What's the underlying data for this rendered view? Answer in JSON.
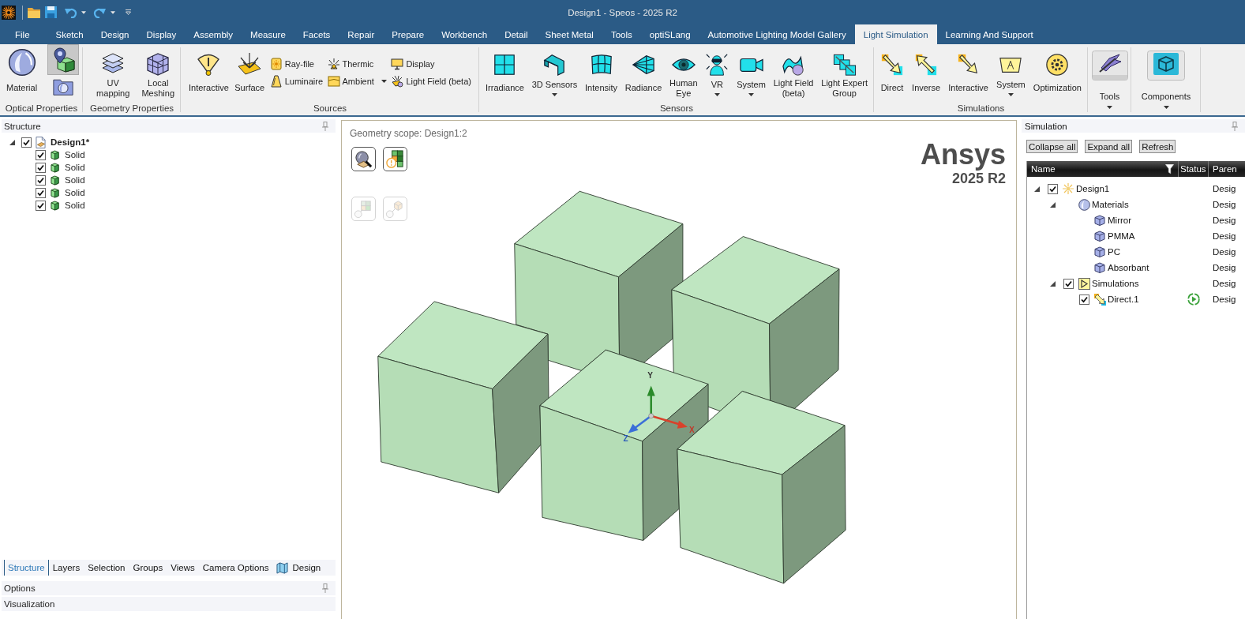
{
  "title_bar": {
    "title": "Design1 - Speos - 2025 R2"
  },
  "menu_tabs": [
    {
      "label": "File",
      "selected": false
    },
    {
      "label": "Sketch",
      "selected": false
    },
    {
      "label": "Design",
      "selected": false
    },
    {
      "label": "Display",
      "selected": false
    },
    {
      "label": "Assembly",
      "selected": false
    },
    {
      "label": "Measure",
      "selected": false
    },
    {
      "label": "Facets",
      "selected": false
    },
    {
      "label": "Repair",
      "selected": false
    },
    {
      "label": "Prepare",
      "selected": false
    },
    {
      "label": "Workbench",
      "selected": false
    },
    {
      "label": "Detail",
      "selected": false
    },
    {
      "label": "Sheet Metal",
      "selected": false
    },
    {
      "label": "Tools",
      "selected": false
    },
    {
      "label": "optiSLang",
      "selected": false
    },
    {
      "label": "Automotive Lighting Model Gallery",
      "selected": false
    },
    {
      "label": "Light Simulation",
      "selected": true
    },
    {
      "label": "Learning And Support",
      "selected": false
    }
  ],
  "ribbon": {
    "groups": [
      {
        "label": "Optical Properties",
        "items": [
          {
            "kind": "large",
            "label": "Material"
          },
          {
            "kind": "stack",
            "items": [
              {
                "kind": "icon",
                "pressed": true
              },
              {
                "kind": "icon",
                "pressed": false
              }
            ]
          }
        ]
      },
      {
        "label": "Geometry Properties",
        "items": [
          {
            "kind": "large",
            "label": "UV mapping"
          },
          {
            "kind": "large",
            "label": "Local\nMeshing"
          }
        ]
      },
      {
        "label": "Sources",
        "items": [
          {
            "kind": "large",
            "label": "Interactive"
          },
          {
            "kind": "large",
            "label": "Surface"
          },
          {
            "kind": "stack",
            "items": [
              {
                "kind": "small",
                "label": "Ray-file"
              },
              {
                "kind": "small",
                "label": "Luminaire"
              }
            ]
          },
          {
            "kind": "stack",
            "items": [
              {
                "kind": "small",
                "label": "Thermic"
              },
              {
                "kind": "small",
                "label": "Ambient",
                "dropdown": true
              }
            ]
          },
          {
            "kind": "stack",
            "items": [
              {
                "kind": "small",
                "label": "Display"
              },
              {
                "kind": "small",
                "label": "Light Field (beta)"
              }
            ]
          }
        ]
      },
      {
        "label": "Sensors",
        "items": [
          {
            "kind": "large",
            "label": "Irradiance"
          },
          {
            "kind": "large",
            "label": "3D Sensors",
            "dropdown": true
          },
          {
            "kind": "large",
            "label": "Intensity"
          },
          {
            "kind": "large",
            "label": "Radiance"
          },
          {
            "kind": "large",
            "label": "Human\nEye"
          },
          {
            "kind": "large",
            "label": "VR",
            "dropdown": true
          },
          {
            "kind": "large",
            "label": "System",
            "dropdown": true
          },
          {
            "kind": "large",
            "label": "Light Field\n(beta)"
          },
          {
            "kind": "large",
            "label": "Light Expert\nGroup"
          }
        ]
      },
      {
        "label": "Simulations",
        "items": [
          {
            "kind": "large",
            "label": "Direct"
          },
          {
            "kind": "large",
            "label": "Inverse"
          },
          {
            "kind": "large",
            "label": "Interactive"
          },
          {
            "kind": "large",
            "label": "System",
            "dropdown": true
          },
          {
            "kind": "large",
            "label": "Optimization"
          }
        ]
      },
      {
        "items": [
          {
            "kind": "tile",
            "label": "Tools",
            "dropdown": true
          }
        ]
      },
      {
        "items": [
          {
            "kind": "tile",
            "label": "Components",
            "dropdown": true
          }
        ]
      }
    ]
  },
  "structure_panel": {
    "title": "Structure",
    "tree": [
      {
        "label": "Design1*",
        "kind": "design",
        "checked": true,
        "expanded": true,
        "children": [
          {
            "label": "Solid",
            "kind": "solid",
            "checked": true
          },
          {
            "label": "Solid",
            "kind": "solid",
            "checked": true
          },
          {
            "label": "Solid",
            "kind": "solid",
            "checked": true
          },
          {
            "label": "Solid",
            "kind": "solid",
            "checked": true
          },
          {
            "label": "Solid",
            "kind": "solid",
            "checked": true
          }
        ]
      }
    ],
    "tabs": [
      {
        "label": "Structure",
        "kind": "text",
        "selected": true
      },
      {
        "label": "Layers",
        "kind": "text",
        "selected": false
      },
      {
        "label": "Selection",
        "kind": "text",
        "selected": false
      },
      {
        "label": "Groups",
        "kind": "text",
        "selected": false
      },
      {
        "label": "Views",
        "kind": "text",
        "selected": false
      },
      {
        "label": "Camera Options",
        "kind": "text",
        "selected": false
      },
      {
        "label": "Design",
        "kind": "icon-text",
        "selected": false
      }
    ],
    "sections": [
      {
        "title": "Options",
        "kind": "pinned"
      },
      {
        "title": "Visualization",
        "kind": "plain"
      }
    ]
  },
  "viewport": {
    "scope_label": "Geometry scope: Design1:2",
    "tool_buttons": [
      {
        "disabled": false
      },
      {
        "disabled": false
      },
      {
        "disabled": true
      },
      {
        "disabled": true
      }
    ],
    "logo": {
      "brand": "Ansys",
      "version": "2025 R2"
    },
    "axis_labels": {
      "y": "Y",
      "x": "X",
      "z": "Z"
    }
  },
  "simulation_panel": {
    "title": "Simulation",
    "buttons": [
      "Collapse all",
      "Expand all",
      "Refresh"
    ],
    "table": {
      "columns": [
        "Name",
        "Status",
        "Paren"
      ],
      "rows": [
        {
          "name": "Design1",
          "kind": "design",
          "checked": true,
          "expanded": true,
          "parent": "Desig",
          "children": [
            {
              "name": "Materials",
              "kind": "materials",
              "expanded": true,
              "parent": "Desig",
              "children": [
                {
                  "name": "Mirror",
                  "kind": "material",
                  "parent": "Desig"
                },
                {
                  "name": "PMMA",
                  "kind": "material",
                  "parent": "Desig"
                },
                {
                  "name": "PC",
                  "kind": "material",
                  "parent": "Desig"
                },
                {
                  "name": "Absorbant",
                  "kind": "material",
                  "parent": "Desig"
                }
              ]
            },
            {
              "name": "Simulations",
              "kind": "simulations",
              "checked": true,
              "expanded": true,
              "parent": "Desig",
              "children": [
                {
                  "name": "Direct.1",
                  "kind": "simulation",
                  "checked": true,
                  "ready": true,
                  "parent": "Desig"
                }
              ]
            }
          ]
        }
      ]
    }
  }
}
